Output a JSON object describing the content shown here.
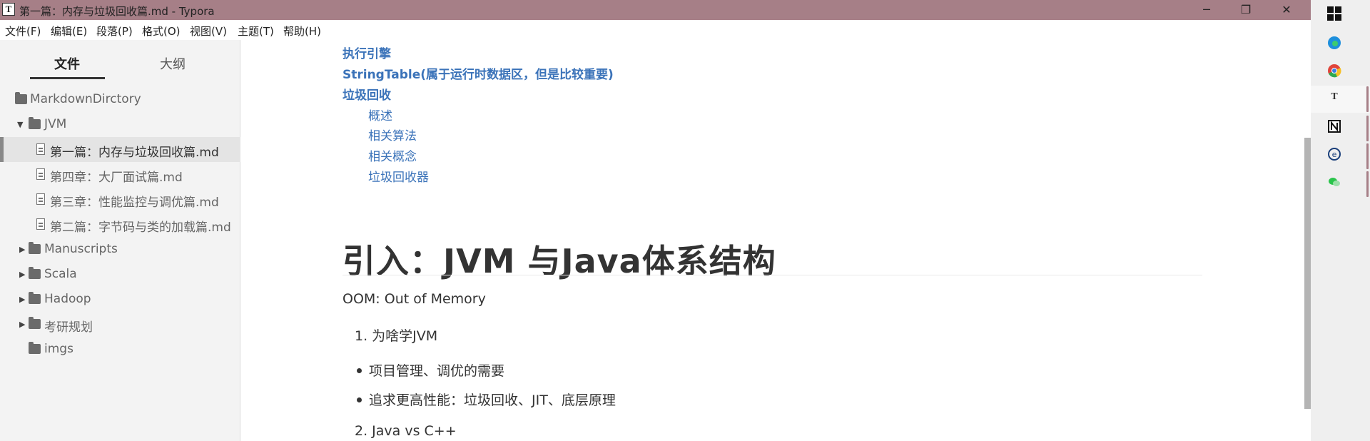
{
  "window": {
    "title": "第一篇：内存与垃圾回收篇.md - Typora",
    "app_icon": "T",
    "controls": {
      "minimize": "─",
      "maximize": "❐",
      "close": "✕"
    }
  },
  "menu": [
    "文件(F)",
    "编辑(E)",
    "段落(P)",
    "格式(O)",
    "视图(V)",
    "主题(T)",
    "帮助(H)"
  ],
  "sidebar": {
    "tabs": {
      "files": "文件",
      "outline": "大纲"
    },
    "tree": [
      {
        "label": "MarkdownDirctory",
        "type": "folder"
      },
      {
        "label": "JVM",
        "type": "folder",
        "expanded": true
      },
      {
        "label": "第一篇：内存与垃圾回收篇.md",
        "type": "file",
        "active": true
      },
      {
        "label": "第四章：大厂面试篇.md",
        "type": "file"
      },
      {
        "label": "第三章：性能监控与调优篇.md",
        "type": "file"
      },
      {
        "label": "第二篇：字节码与类的加载篇.md",
        "type": "file"
      },
      {
        "label": "Manuscripts",
        "type": "folder",
        "collapsed": true
      },
      {
        "label": "Scala",
        "type": "folder",
        "collapsed": true
      },
      {
        "label": "Hadoop",
        "type": "folder",
        "collapsed": true
      },
      {
        "label": "考研规划",
        "type": "folder",
        "collapsed": true
      },
      {
        "label": "imgs",
        "type": "folder"
      }
    ]
  },
  "doc": {
    "toc": {
      "engine": "执行引擎",
      "stringtable": "StringTable(属于运行时数据区，但是比较重要)",
      "gc": "垃圾回收",
      "gc_overview": "概述",
      "gc_algorithms": "相关算法",
      "gc_concepts": "相关概念",
      "gc_collectors": "垃圾回收器"
    },
    "heading": "引入：JVM 与Java体系结构",
    "oom": "OOM: Out of Memory",
    "item1": "1. 为啥学JVM",
    "bullet1": "项目管理、调优的需要",
    "bullet2": "追求更高性能：垃圾回收、JIT、底层原理",
    "item2": "2. Java vs C++"
  },
  "taskbar": [
    "windows-logo-icon",
    "edge-icon",
    "chrome-icon",
    "typora-icon",
    "notion-icon",
    "ie-icon",
    "wechat-icon"
  ],
  "colors": {
    "titlebar": "#a67f87",
    "link": "#3b73b9"
  }
}
